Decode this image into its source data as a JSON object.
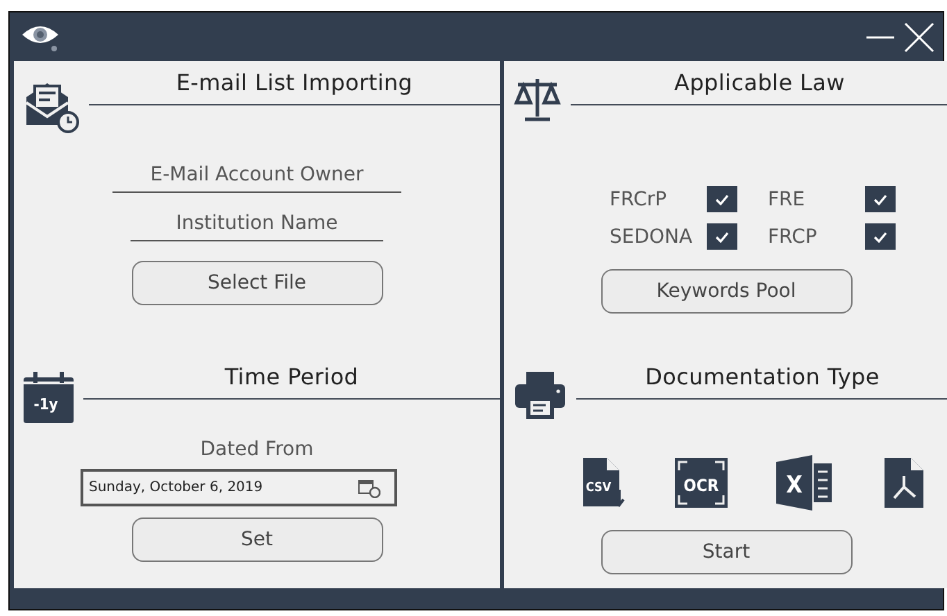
{
  "email_section": {
    "title": "E-mail List Importing",
    "fields": [
      {
        "placeholder": "E-Mail Account Owner"
      },
      {
        "placeholder": "Institution Name"
      }
    ],
    "button": "Select File"
  },
  "time_section": {
    "title": "Time Period",
    "icon_label": "-1y",
    "label": "Dated From",
    "date_value": "Sunday, October 6, 2019",
    "button": "Set"
  },
  "law_section": {
    "title": "Applicable Law",
    "items": [
      {
        "label": "FRCrP",
        "checked": true
      },
      {
        "label": "FRE",
        "checked": true
      },
      {
        "label": "SEDONA",
        "checked": true
      },
      {
        "label": "FRCP",
        "checked": true
      }
    ],
    "button": "Keywords Pool"
  },
  "doc_section": {
    "title": "Documentation Type",
    "types": [
      {
        "kind": "csv",
        "label": "CSV"
      },
      {
        "kind": "ocr",
        "label": "OCR"
      },
      {
        "kind": "excel",
        "label": "X"
      },
      {
        "kind": "pdf"
      }
    ],
    "button": "Start"
  }
}
